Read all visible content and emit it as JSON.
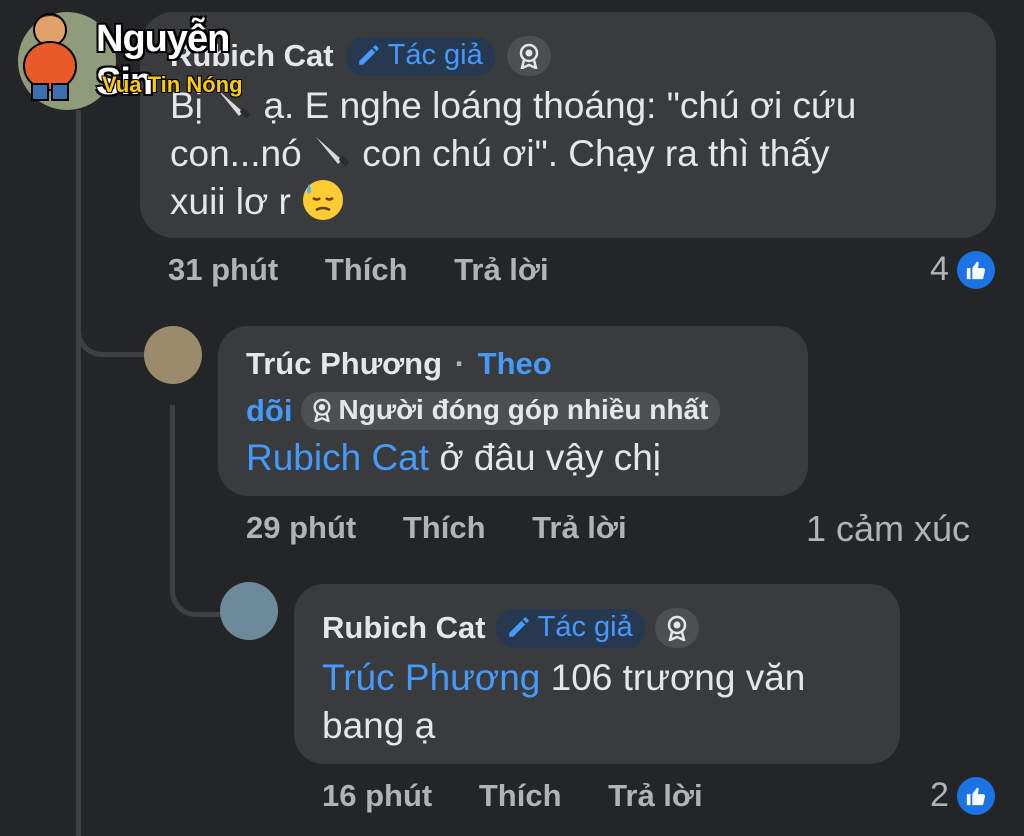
{
  "watermark": {
    "title": "Nguyễn Sin",
    "subtitle": "Vua Tin Nóng"
  },
  "comment1": {
    "author": "Rubich Cat",
    "badge": "Tác giả",
    "line1": "Bị",
    "line1b": "ạ. E nghe loáng thoáng: \"chú ơi cứu",
    "line2a": "con...nó",
    "line2b": "con chú ơi\". Chạy ra thì thấy",
    "line3": "xuii lơ r",
    "time": "31 phút",
    "like": "Thích",
    "reply": "Trả lời",
    "reactions": "4"
  },
  "comment2": {
    "author": "Trúc Phương",
    "separator": "·",
    "follow_part1": "Theo",
    "follow_part2": "dõi",
    "contributor_badge": "Người đóng góp nhiều nhất",
    "mention": "Rubich Cat",
    "text": "ở đâu vậy chị",
    "time": "29 phút",
    "like": "Thích",
    "reply": "Trả lời",
    "reactions": "1 cảm xúc"
  },
  "comment3": {
    "author": "Rubich Cat",
    "badge": "Tác giả",
    "mention": "Trúc Phương",
    "text1": "106 trương văn",
    "text2": "bang ạ",
    "time": "16 phút",
    "like": "Thích",
    "reply": "Trả lời",
    "reactions": "2"
  },
  "icons": {
    "pencil": "pencil-icon",
    "knife": "knife-emoji",
    "sweat": "downcast-sweat-emoji",
    "like": "thumbs-up-icon",
    "ribbon": "award-badge-icon"
  },
  "colors": {
    "background": "#242526",
    "bubble": "#3a3b3c",
    "link": "#4599ff",
    "like": "#1b74e4"
  }
}
